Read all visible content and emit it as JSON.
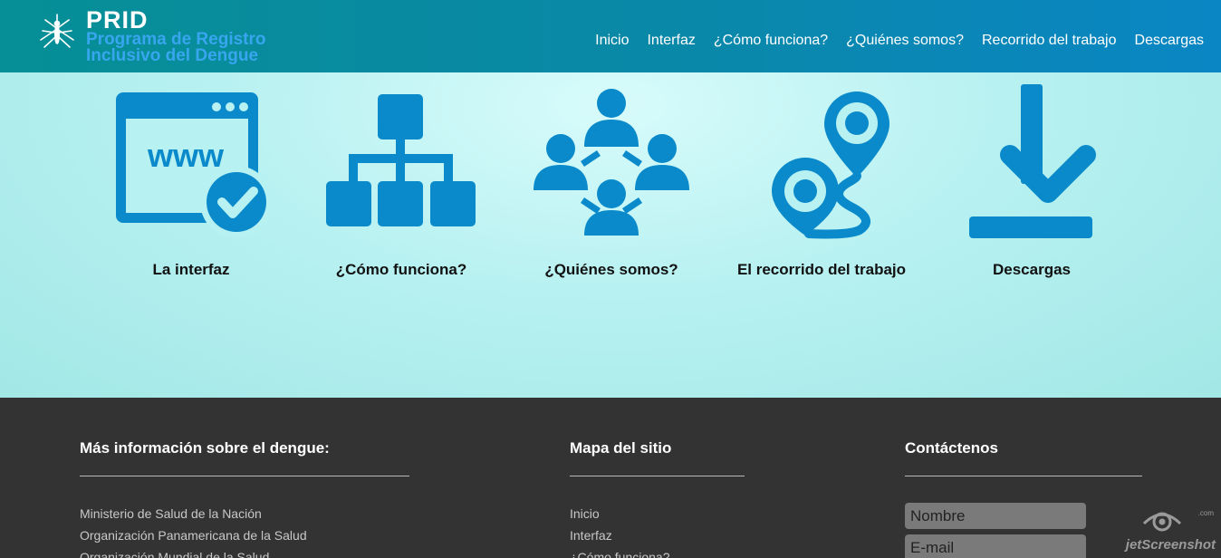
{
  "header": {
    "brand_title": "PRID",
    "brand_subtitle": "Programa de Registro Inclusivo del Dengue",
    "logo_icon": "mosquito-icon",
    "nav": [
      "Inicio",
      "Interfaz",
      "¿Cómo funciona?",
      "¿Quiénes somos?",
      "Recorrido del trabajo",
      "Descargas"
    ]
  },
  "features": [
    {
      "label": "La interfaz",
      "icon": "www-browser-check-icon"
    },
    {
      "label": "¿Cómo funciona?",
      "icon": "hierarchy-diagram-icon"
    },
    {
      "label": "¿Quiénes somos?",
      "icon": "team-network-icon"
    },
    {
      "label": "El recorrido del trabajo",
      "icon": "route-map-icon"
    },
    {
      "label": "Descargas",
      "icon": "download-icon"
    }
  ],
  "footer": {
    "info_title": "Más información sobre el dengue:",
    "info_links": [
      "Ministerio de Salud de la Nación",
      "Organización Panamericana de la Salud",
      "Organización Mundial de la Salud"
    ],
    "sitemap_title": "Mapa del sitio",
    "sitemap_links": [
      "Inicio",
      "Interfaz",
      "¿Cómo funciona?"
    ],
    "contact_title": "Contáctenos",
    "name_placeholder": "Nombre",
    "email_placeholder": "E-mail"
  },
  "watermark": {
    "text": "jetScreenshot",
    "suffix": ".com"
  },
  "colors": {
    "header_teal": "#068f96",
    "header_blue": "#0a86c4",
    "icon_blue": "#0a8acb",
    "hero_light": "#b8f1f1",
    "footer_bg": "#333333"
  }
}
